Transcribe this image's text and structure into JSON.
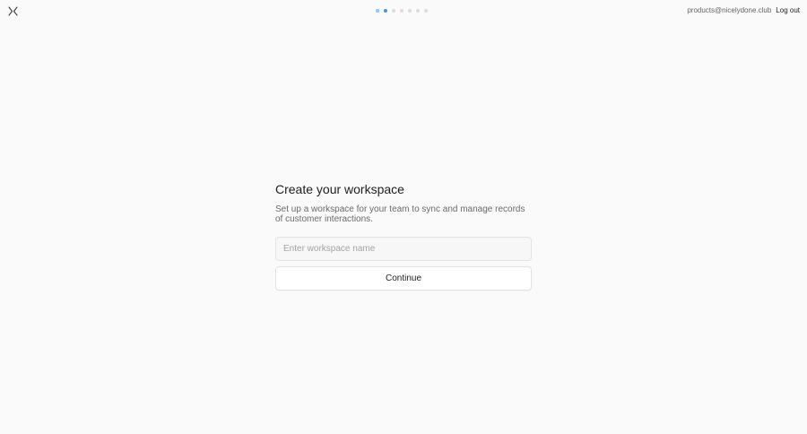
{
  "header": {
    "logo_icon": "close-x-logo-icon",
    "progress": {
      "total_steps": 7,
      "completed_steps": 1,
      "current_step": 2
    },
    "account": {
      "email": "products@nicelydone.club",
      "logout_label": "Log out"
    }
  },
  "main": {
    "title": "Create your workspace",
    "subtitle": "Set up a workspace for your team to sync and manage records of customer interactions.",
    "workspace_input": {
      "value": "",
      "placeholder": "Enter workspace name"
    },
    "continue_label": "Continue"
  },
  "colors": {
    "background": "#fafafa",
    "progress_active": "#3d9be9",
    "progress_done": "#8cc6f2",
    "progress_pending": "#dcdcdf"
  }
}
